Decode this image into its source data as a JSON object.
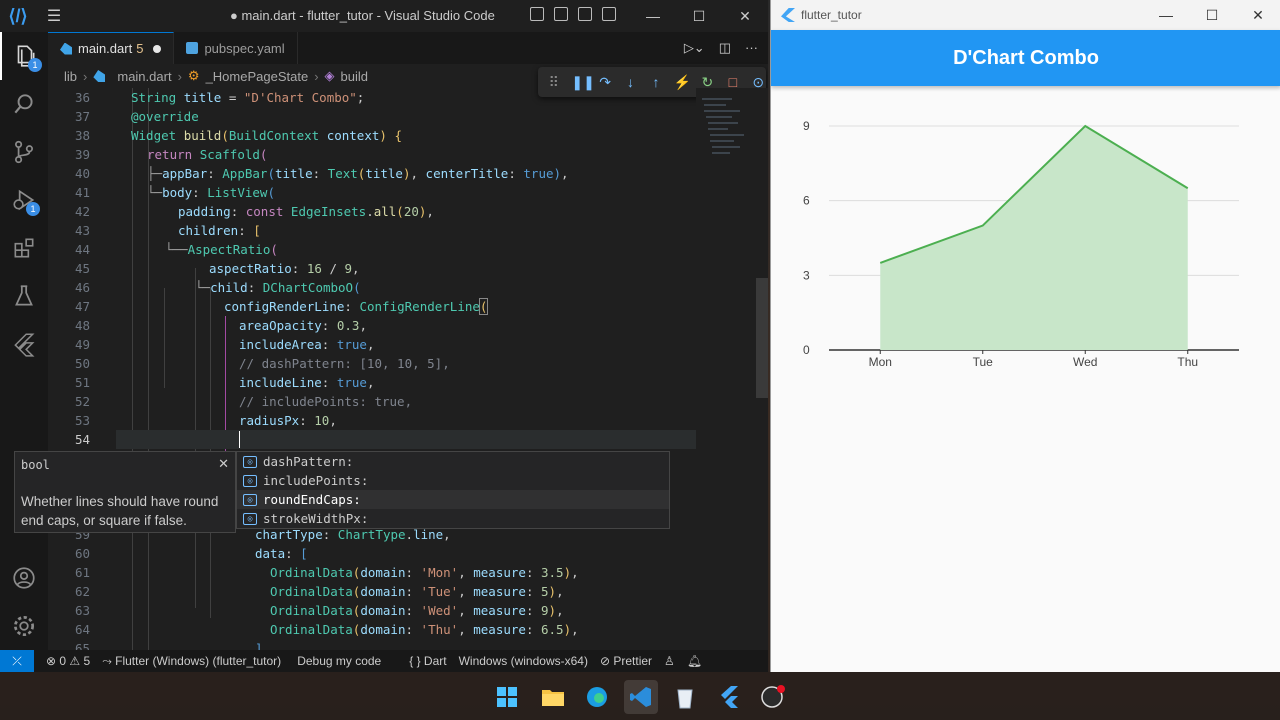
{
  "vscode": {
    "window_title": "● main.dart - flutter_tutor - Visual Studio Code",
    "tabs": [
      {
        "label": "main.dart",
        "problems": "5"
      },
      {
        "label": "pubspec.yaml"
      }
    ],
    "breadcrumb": [
      "lib",
      "main.dart",
      "_HomePageState",
      "build"
    ],
    "lines": [
      {
        "num": "36"
      },
      {
        "num": "37"
      },
      {
        "num": "38"
      },
      {
        "num": "39"
      },
      {
        "num": "40"
      },
      {
        "num": "41"
      },
      {
        "num": "42"
      },
      {
        "num": "43"
      },
      {
        "num": "44"
      },
      {
        "num": "45"
      },
      {
        "num": "46"
      },
      {
        "num": "47"
      },
      {
        "num": "48"
      },
      {
        "num": "49"
      },
      {
        "num": "50"
      },
      {
        "num": "51"
      },
      {
        "num": "52"
      },
      {
        "num": "53"
      },
      {
        "num": "54"
      },
      {
        "num": "59"
      },
      {
        "num": "60"
      },
      {
        "num": "61"
      },
      {
        "num": "62"
      },
      {
        "num": "63"
      },
      {
        "num": "64"
      },
      {
        "num": "65"
      }
    ],
    "hover_doc": {
      "signature": "bool",
      "description": "Whether lines should have round end caps, or square if false."
    },
    "suggestions": [
      {
        "label": "dashPattern:"
      },
      {
        "label": "includePoints:"
      },
      {
        "label": "roundEndCaps:",
        "selected": true
      },
      {
        "label": "strokeWidthPx:"
      }
    ],
    "statusbar": {
      "errors": "0",
      "warnings": "5",
      "device_session": "Flutter (Windows) (flutter_tutor)",
      "debug": "Debug my code",
      "language": "Dart",
      "platform": "Windows (windows-x64)",
      "formatter": "Prettier"
    }
  },
  "flutter_app": {
    "window_title": "flutter_tutor",
    "appbar_title": "D'Chart Combo"
  },
  "chart_data": {
    "type": "area",
    "categories": [
      "Mon",
      "Tue",
      "Wed",
      "Thu"
    ],
    "values": [
      3.5,
      5,
      9,
      6.5
    ],
    "yticks": [
      "0",
      "3",
      "6",
      "9"
    ],
    "ylim": [
      0,
      9
    ],
    "grid": true,
    "line_color": "#4caf50",
    "area_color": "#c8e6c9"
  },
  "colors": {
    "vscode_bg": "#1f1f1f",
    "accent": "#0078d4",
    "appbar": "#2196f3"
  }
}
